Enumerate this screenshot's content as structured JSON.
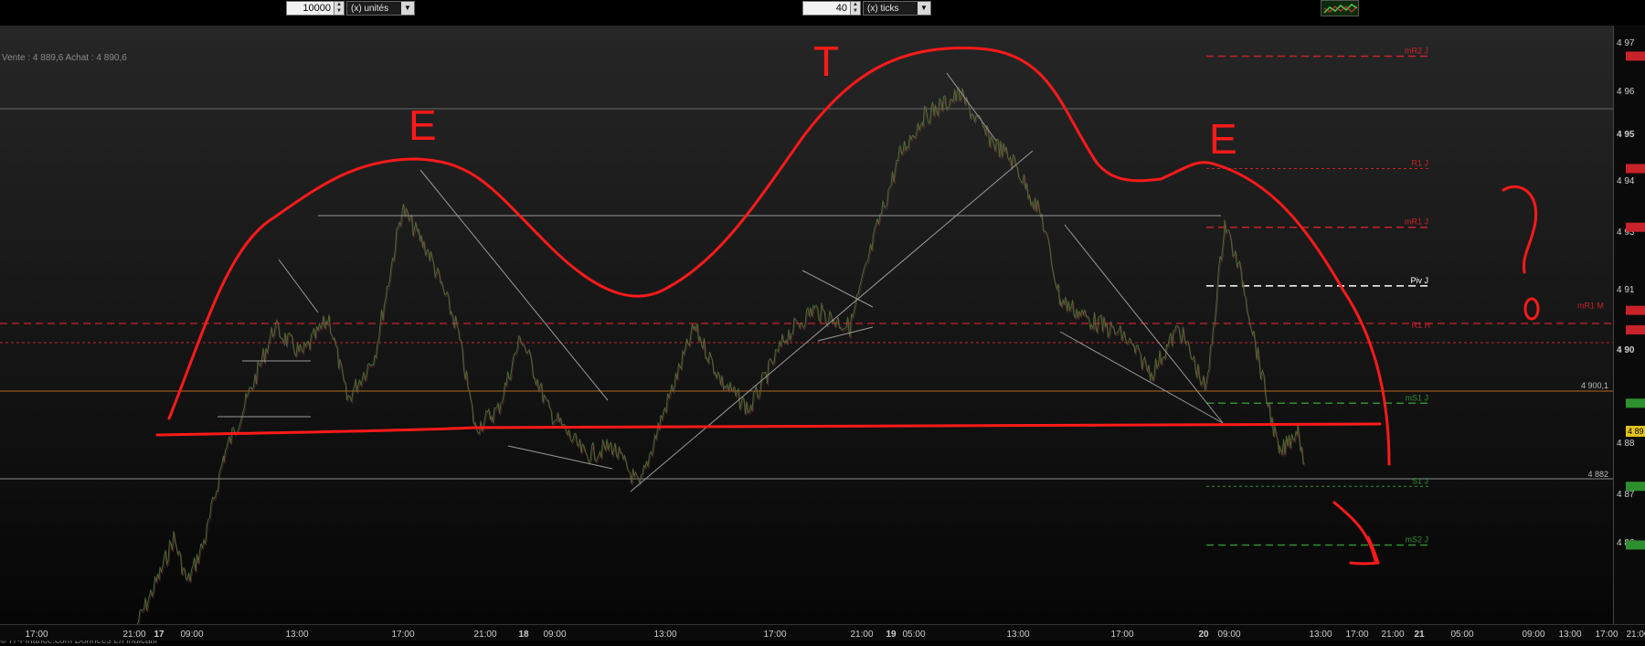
{
  "toolbar": {
    "units_value": "10000",
    "units_label": "(x) unités",
    "ticks_value": "40",
    "ticks_label": "(x) ticks"
  },
  "quote_line": "Vente : 4 889,6 Achat : 4 890,6",
  "credit": {
    "source": "© IT-Finance.com",
    "note": "Données en indicatif"
  },
  "annotations": {
    "letter_1": "E",
    "letter_2": "T",
    "letter_3": "E",
    "question": "?"
  },
  "colors": {
    "background_top": "#262626",
    "background_bottom": "#060606",
    "annotation": "#ff1a1a",
    "resistance": "#c8232a",
    "support": "#2e8f2e",
    "pivot": "#ffffff"
  },
  "chart_data": {
    "type": "line",
    "y_tick_labels": [
      "4 97",
      "4 96",
      "4 95",
      "4 94",
      "4 93",
      "4 91",
      "4 90",
      "4 88",
      "4 87",
      "4 86"
    ],
    "x_tick_labels": [
      "17:00",
      "21:00",
      "17",
      "09:00",
      "13:00",
      "17:00",
      "21:00",
      "18",
      "09:00",
      "13:00",
      "17:00",
      "21:00",
      "19",
      "05:00",
      "13:00",
      "17:00",
      "20",
      "09:00",
      "13:00",
      "17:00",
      "21:00",
      "21",
      "05:00",
      "09:00",
      "13:00",
      "17:00",
      "21:00"
    ],
    "levels": [
      {
        "name": "mR2 J",
        "value": 4966,
        "color": "#c8232a",
        "style": "dashed"
      },
      {
        "name": "R1 J",
        "value": 4943,
        "color": "#c8232a",
        "style": "dotted"
      },
      {
        "name": "mR1 J",
        "value": 4931,
        "color": "#c8232a",
        "style": "dashed"
      },
      {
        "name": "Piv J",
        "value": 4919,
        "color": "#ffffff",
        "style": "dashed"
      },
      {
        "name": "mR1 M",
        "value": 4914,
        "color": "#c8232a",
        "style": "dashed"
      },
      {
        "name": "R1 H",
        "value": 4910,
        "color": "#c8232a",
        "style": "dotted"
      },
      {
        "name": "mS1 J",
        "value": 4895,
        "color": "#2e8f2e",
        "style": "dashed"
      },
      {
        "name": "S1 J",
        "value": 4878,
        "color": "#2e8f2e",
        "style": "dotted"
      },
      {
        "name": "mS2 J",
        "value": 4866,
        "color": "#2e8f2e",
        "style": "dashed"
      }
    ],
    "price_labels": [
      "4 900,1",
      "4 882"
    ],
    "current_price": "4 89"
  }
}
